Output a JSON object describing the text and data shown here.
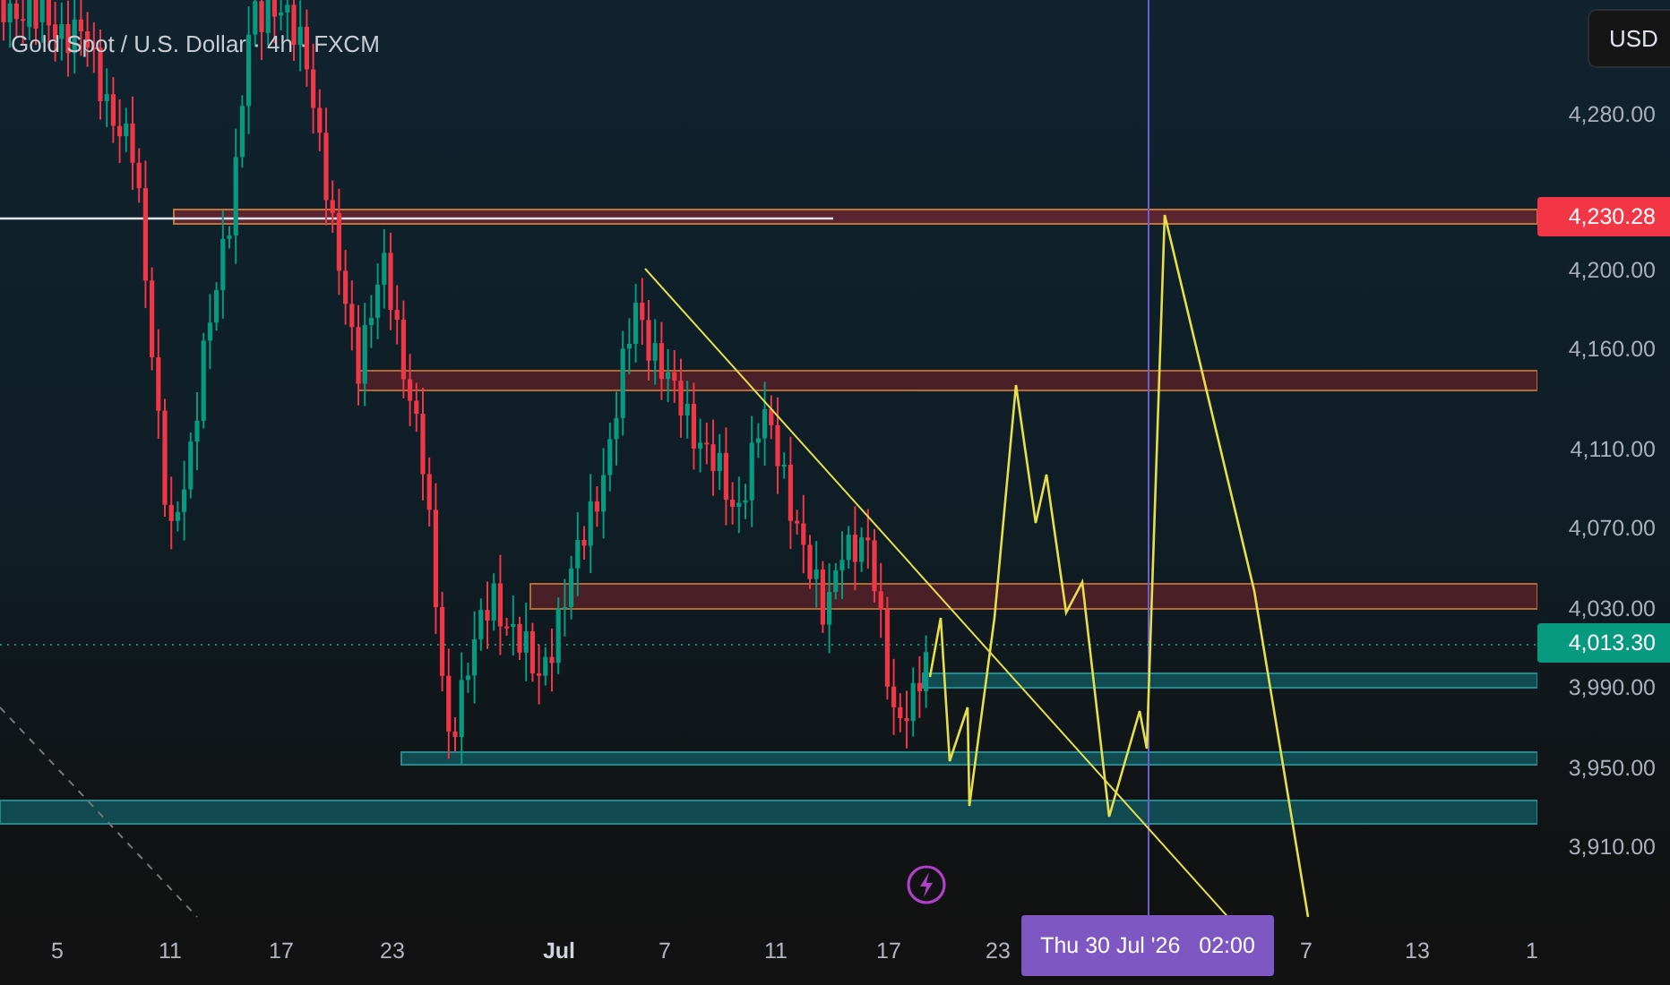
{
  "symbol_title": "Gold Spot / U.S. Dollar · 4h · FXCM",
  "currency_button": "USD",
  "price_axis": [
    "4,280.00",
    "4,200.00",
    "4,160.00",
    "4,110.00",
    "4,070.00",
    "4,030.00",
    "3,990.00",
    "3,950.00",
    "3,910.00"
  ],
  "price_badges": [
    {
      "text": "4,230.28",
      "color": "#f23645"
    },
    {
      "text": "4,013.30",
      "color": "#089981"
    }
  ],
  "time_axis": [
    {
      "text": "5",
      "bold": false
    },
    {
      "text": "11",
      "bold": false
    },
    {
      "text": "17",
      "bold": false
    },
    {
      "text": "23",
      "bold": false
    },
    {
      "text": "Jul",
      "bold": true
    },
    {
      "text": "7",
      "bold": false
    },
    {
      "text": "11",
      "bold": false
    },
    {
      "text": "17",
      "bold": false
    },
    {
      "text": "23",
      "bold": false
    },
    {
      "text": "7",
      "bold": false
    },
    {
      "text": "13",
      "bold": false
    },
    {
      "text": "1",
      "bold": false
    }
  ],
  "crosshair_date": "Thu 30 Jul '26   02:00"
}
